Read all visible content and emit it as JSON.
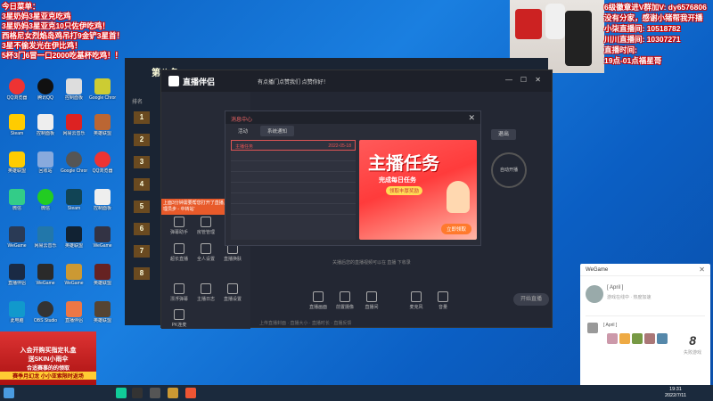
{
  "overlay_left": {
    "lines": [
      "今日菜单：",
      "3星奶妈3星亚克吃鸡",
      "3星奶妈3星亚克10只佐伊吃鸡！",
      "西格尼女烈焰岛鸡吊打9金铲3星首！",
      "3星不偷发光在伊比鸡！",
      "5杯3门6冒一口2000吃基杯吃鸡！！"
    ]
  },
  "overlay_right": {
    "lines": [
      "6级徽章进V群加V: dy6576806",
      "没有分家，感谢小猪帮我开播",
      "小柒直播间: 10518782",
      "川川直播间: 10307271",
      "直播时间:",
      "19点-01点福星哥"
    ]
  },
  "game": {
    "title": "第八名",
    "tab": "排名",
    "ranks": [
      "1",
      "2",
      "3",
      "4",
      "5",
      "6",
      "7",
      "8"
    ]
  },
  "liveapp": {
    "title": "直播伴侣",
    "ticker": "有点播门点赞我们 点赞你好！",
    "end_button": "退出",
    "side_labels": [
      "弹幕助手",
      "房管管理",
      "直播换肤",
      "超长直播",
      "全人设置",
      "漂浮弹幕",
      "主播日志",
      "直播设置",
      "PK连麦"
    ],
    "bottom_tools": [
      "直播画面",
      "前置摄像",
      "直播间",
      "麦克风",
      "音量",
      "扬声器"
    ],
    "start_button": "开始直播",
    "status": "上面3分钟需要帮您打开了直播，现在，'管理员步 - 中转站'",
    "hint": "关播后您的直播视频可以在 直播 下收录",
    "bottom_hint": "上传直播封面 · 直播大小 · 直播时长 · 直播反馈",
    "live_button": "自动开播"
  },
  "message_center": {
    "title": "消息中心",
    "tabs": [
      "活动",
      "系统通知"
    ],
    "items": [
      {
        "title": "主播任务",
        "date": "2022-05-18"
      }
    ],
    "banner": {
      "headline": "主播任务",
      "sub": "完成每日任务",
      "tag": "领取丰厚奖励",
      "cta": "立即领取"
    }
  },
  "wegame": {
    "title": "WeGame",
    "user": "[ April ]",
    "status": "游戏在线中 · 热度加速",
    "user2": "[ April ]",
    "placement": "8",
    "placement_label": "失败游戏"
  },
  "desktop_icons": [
    "QQ浏览器",
    "腾讯QQ",
    "网易云音乐",
    "微信",
    "Steam",
    "英雄联盟",
    "WeGame",
    "Google Chrome",
    "直播伴侣",
    "OBS Studio",
    "此电脑",
    "回收站",
    "控制面板"
  ],
  "ad": {
    "line1": "入会开购买指定礼盒",
    "line2": "送SKIN小雨伞",
    "line3": "合适赛事的的领取",
    "line4": "赛季月幻龙 小小亚索限时返场"
  },
  "clock": {
    "time": "19:31",
    "date": "2022/7/11"
  }
}
